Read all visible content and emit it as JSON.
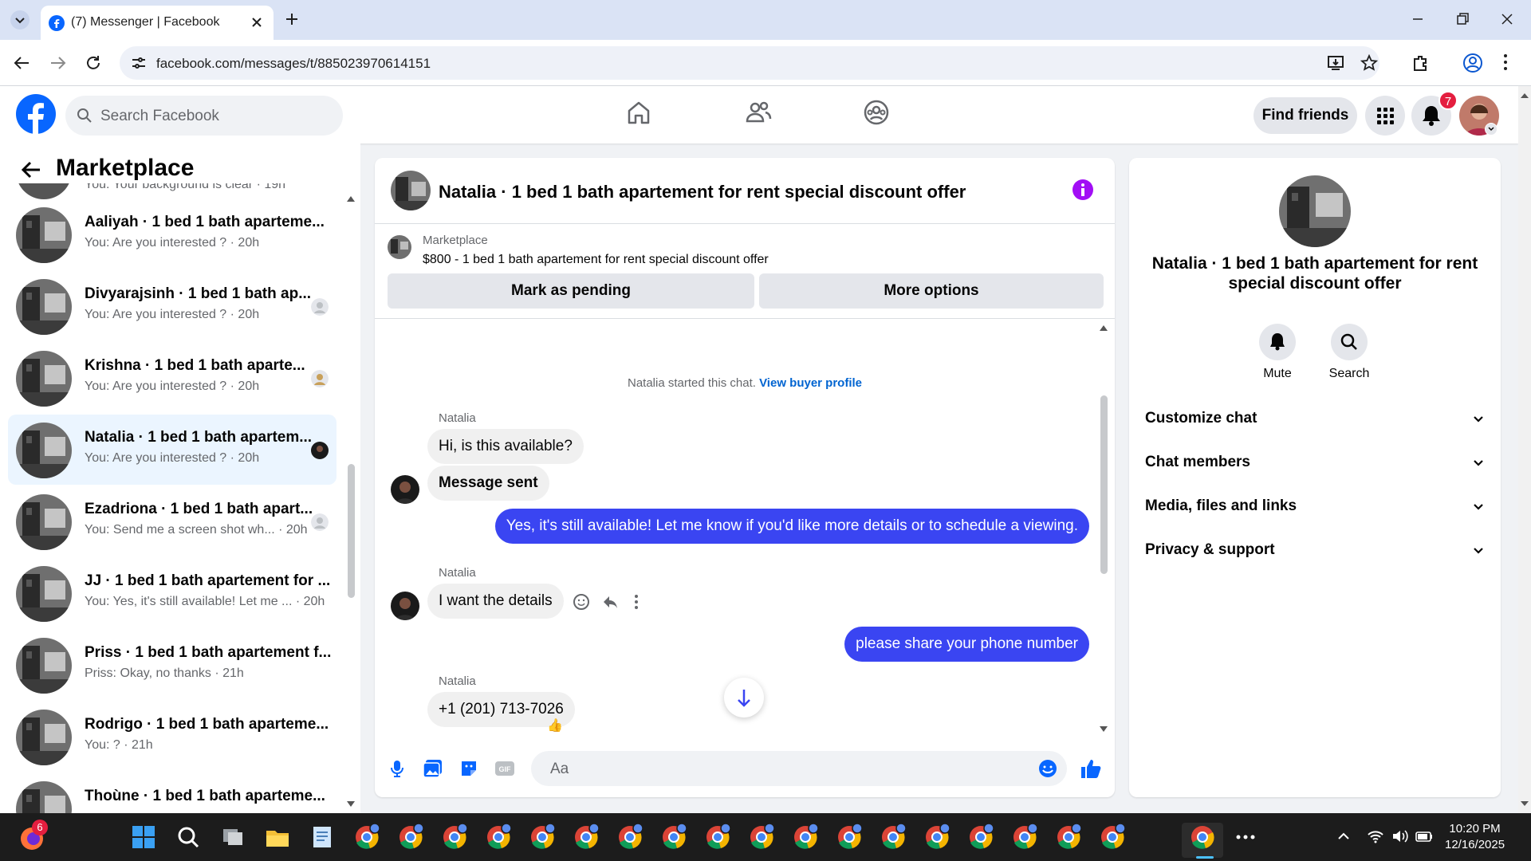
{
  "browser": {
    "tab_title": "(7) Messenger | Facebook",
    "url": "facebook.com/messages/t/885023970614151"
  },
  "facebook": {
    "search_placeholder": "Search Facebook",
    "find_friends": "Find friends",
    "notification_count": "7",
    "brand_color": "#0866ff"
  },
  "sidebar": {
    "title": "Marketplace",
    "partial_top_preview": "You: Your background is clear · 19h",
    "conversations": [
      {
        "name": "Aaliyah · 1 bed 1 bath aparteme...",
        "preview": "You: Are you interested ? · 20h"
      },
      {
        "name": "Divyarajsinh · 1 bed 1 bath ap...",
        "preview": "You: Are you interested ? · 20h"
      },
      {
        "name": "Krishna · 1 bed 1 bath aparte...",
        "preview": "You: Are you interested ? · 20h"
      },
      {
        "name": "Natalia · 1 bed 1 bath apartem...",
        "preview": "You: Are you interested ? · 20h"
      },
      {
        "name": "Ezadriona · 1 bed 1 bath apart...",
        "preview": "You: Send me a screen shot wh... · 20h"
      },
      {
        "name": "JJ · 1 bed 1 bath apartement for ...",
        "preview": "You: Yes, it's still available! Let me ... · 20h"
      },
      {
        "name": "Priss · 1 bed 1 bath apartement f...",
        "preview": "Priss: Okay, no thanks · 21h"
      },
      {
        "name": "Rodrigo · 1 bed 1 bath aparteme...",
        "preview": "You: ? · 21h"
      },
      {
        "name": "Thoùne · 1 bed 1 bath aparteme...",
        "preview": ""
      }
    ]
  },
  "chat": {
    "title": "Natalia · 1 bed 1 bath apartement for rent special discount offer",
    "marketplace_label": "Marketplace",
    "listing": "$800 - 1 bed 1 bath apartement for rent special discount offer",
    "mark_pending": "Mark as pending",
    "more_options": "More options",
    "started_text": "Natalia started this chat.",
    "view_buyer_profile": "View buyer profile",
    "sender_name": "Natalia",
    "messages": [
      {
        "from": "them",
        "text": "Hi, is this available?"
      },
      {
        "from": "them",
        "text": "Message sent"
      },
      {
        "from": "me",
        "text": "Yes, it's still available! Let me know if you'd like more details or to schedule a viewing."
      },
      {
        "from": "them",
        "text": "I want the details"
      },
      {
        "from": "me",
        "text": "please share your phone number"
      },
      {
        "from": "them",
        "text": "+1 (201) 713-7026"
      }
    ],
    "reaction": "👍",
    "composer_placeholder": "Aa",
    "outgoing_color": "#3a45f2"
  },
  "details": {
    "title": "Natalia · 1 bed 1 bath apartement for rent special discount offer",
    "mute": "Mute",
    "search": "Search",
    "sections": [
      "Customize chat",
      "Chat members",
      "Media, files and links",
      "Privacy & support"
    ]
  },
  "taskbar": {
    "time": "10:20 PM",
    "date": "12/16/2025",
    "browser_badge": "6"
  }
}
